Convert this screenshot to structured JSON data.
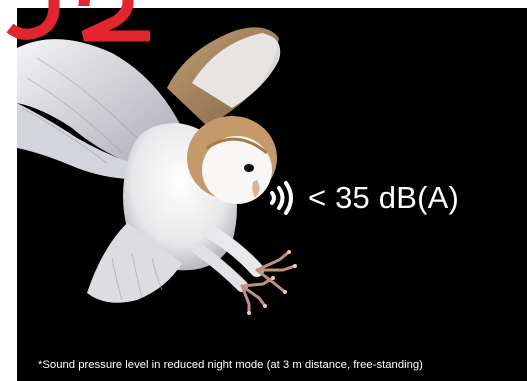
{
  "colors": {
    "background": "#000000",
    "text": "#ffffff",
    "brand_red": "#e3262d"
  },
  "icons": {
    "brand": "brand-logo-fragment",
    "sound": "sound-waves-icon"
  },
  "image": {
    "subject": "barn-owl-in-flight"
  },
  "sound": {
    "value": "< 35 dB(A)"
  },
  "footnote": {
    "text": "*Sound pressure level in reduced night mode (at 3 m distance, free-standing)"
  }
}
